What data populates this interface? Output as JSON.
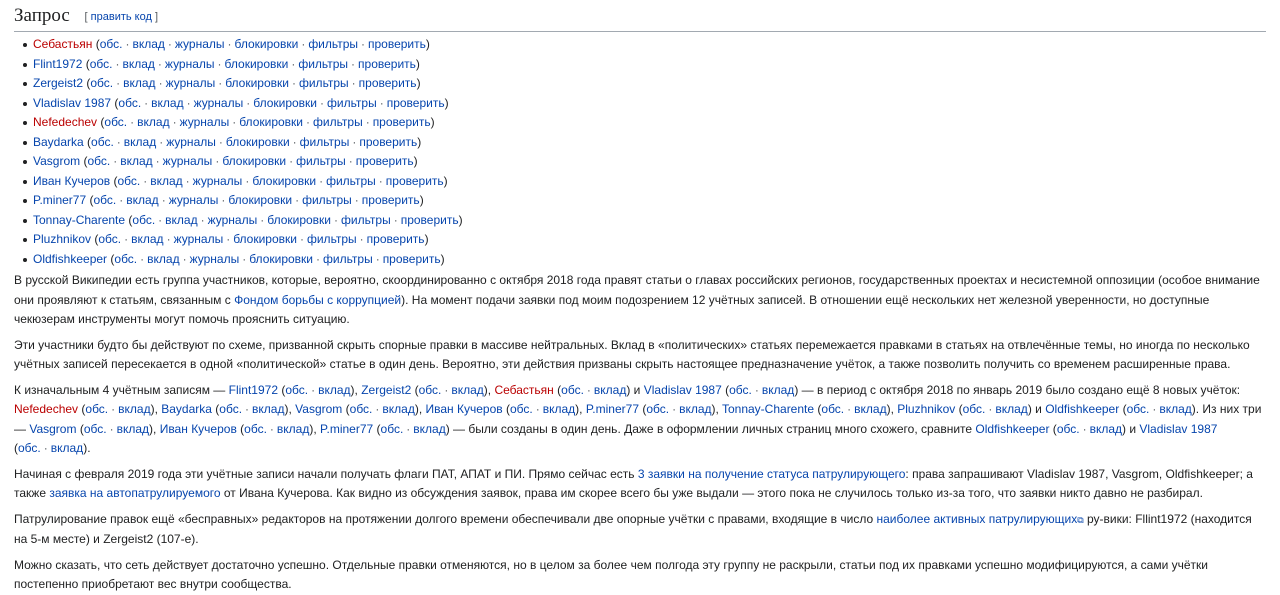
{
  "section": {
    "title": "Запрос",
    "edit_open": "[",
    "edit_label": "править код",
    "edit_close": "]"
  },
  "tools": {
    "obs": "обс.",
    "vklad": "вклад",
    "zhurnaly": "журналы",
    "blokirovki": "блокировки",
    "filtry": "фильтры",
    "proverit": "проверить"
  },
  "users": [
    {
      "name": "Себастьян",
      "red": true
    },
    {
      "name": "Flint1972",
      "red": false
    },
    {
      "name": "Zergeist2",
      "red": false
    },
    {
      "name": "Vladislav 1987",
      "red": false
    },
    {
      "name": "Nefedechev",
      "red": true
    },
    {
      "name": "Baydarka",
      "red": false
    },
    {
      "name": "Vasgrom",
      "red": false
    },
    {
      "name": "Иван Кучеров",
      "red": false
    },
    {
      "name": "P.miner77",
      "red": false
    },
    {
      "name": "Tonnay-Charente",
      "red": false
    },
    {
      "name": "Pluzhnikov",
      "red": false
    },
    {
      "name": "Oldfishkeeper",
      "red": false
    }
  ],
  "p1": {
    "t1": "В русской Википедии есть группа участников, которые, вероятно, скоординированно с октября 2018 года правят статьи о главах российских регионов, государственных проектах и несистемной оппозиции (особое внимание они проявляют к статьям, связанным с ",
    "link1": "Фондом борьбы с коррупцией",
    "t2": "). На момент подачи заявки под моим подозрением 12 учётных записей. В отношении ещё нескольких нет железной уверенности, но доступные чекюзерам инструменты могут помочь прояснить ситуацию."
  },
  "p2": {
    "t1": "Эти участники будто бы действуют по схеме, призванной скрыть спорные правки в массиве нейтральных. Вклад в «политических» статьях перемежается правками в статьях на отвлечённые темы, но иногда по несколько учётных записей пересекается в одной «политической» статье в один день. Вероятно, эти действия призваны скрыть настоящее предназначение учёток, а также позволить получить со временем расширенные права."
  },
  "p3": {
    "t_start": "К изначальным 4 учётным записям — ",
    "t_and1": " и ",
    "t_mid": " — в период с октября 2018 по январь 2019 было создано ещё 8 новых учёток: ",
    "t_and2": " и ",
    "t_three": ". Из них три — ",
    "t_same": " — были созданы в один день. Даже в оформлении личных страниц много схожего, сравните ",
    "t_and3": " и ",
    "t_end": "."
  },
  "p4": {
    "t1": "Начиная с февраля 2019 года эти учётные записи начали получать флаги ПАТ, АПАТ и ПИ. Прямо сейчас есть ",
    "link1": "3 заявки на получение статуса патрулирующего",
    "t2": ": права запрашивают Vladislav 1987, Vasgrom, Oldfishkeeper; а также ",
    "link2": "заявка на автопатрулируемого",
    "t3": " от Ивана Кучерова. Как видно из обсуждения заявок, права им скорее всего бы уже выдали — этого пока не случилось только из-за того, что заявки никто давно не разбирал."
  },
  "p5": {
    "t1": "Патрулирование правок ещё «бесправных» редакторов на протяжении долгого времени обеспечивали две опорные учётки с правами, входящие в число ",
    "link1": "наиболее активных патрулирующих",
    "t2": " ру-вики: Fllint1972 (находится на 5-м месте) и Zergeist2 (107-е)."
  },
  "p6": {
    "t1": "Можно сказать, что сеть действует достаточно успешно. Отдельные правки отменяются, но в целом за более чем полгода эту группу не раскрыли, статьи под их правками успешно модифицируются, а сами учётки постепенно приобретают вес внутри сообщества."
  }
}
